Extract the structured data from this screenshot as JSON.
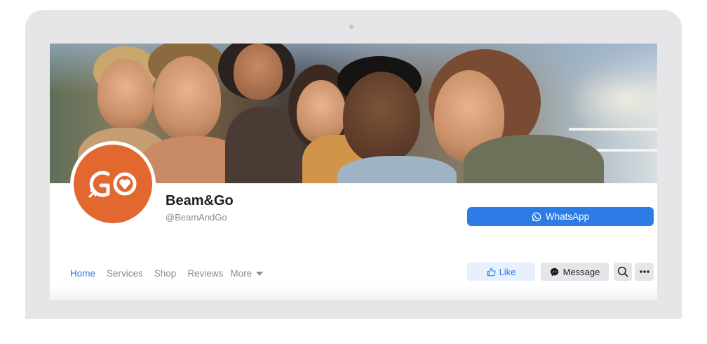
{
  "page": {
    "name": "Beam&Go",
    "handle": "@BeamAndGo",
    "avatar_logo_text": "GO"
  },
  "actions": {
    "whatsapp_label": "WhatsApp",
    "like_label": "Like",
    "message_label": "Message"
  },
  "nav": {
    "tabs": [
      {
        "label": "Home",
        "active": true
      },
      {
        "label": "Services",
        "active": false
      },
      {
        "label": "Shop",
        "active": false
      },
      {
        "label": "Reviews",
        "active": false
      }
    ],
    "more_label": "More"
  },
  "icons": {
    "whatsapp": "whatsapp-icon",
    "like": "thumbs-up-icon",
    "message": "messenger-icon",
    "search": "search-icon",
    "more": "more-dots-icon",
    "dropdown": "caret-down-icon"
  },
  "colors": {
    "brand_orange": "#e2682f",
    "accent_blue": "#2d7be5",
    "like_bg": "#e7f0fc",
    "button_gray": "#e4e6ea"
  }
}
